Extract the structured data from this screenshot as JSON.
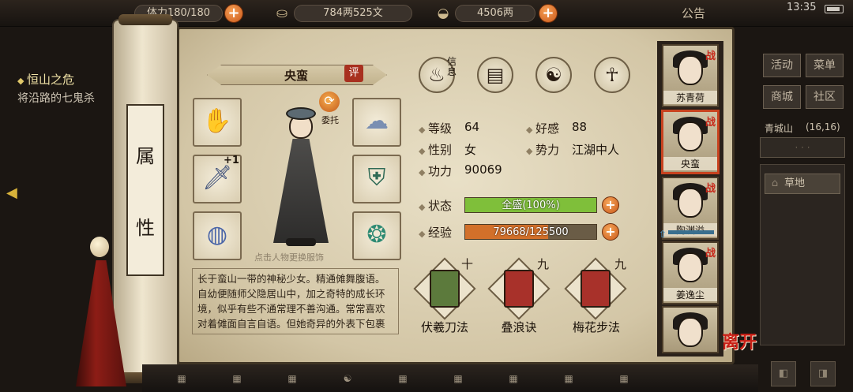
{
  "topbar": {
    "stamina_text": "体力180/180",
    "money_text": "784两525文",
    "gold_text": "4506两",
    "notice_label": "公告",
    "time": "13:35"
  },
  "quest": {
    "title": "恒山之危",
    "desc": "将沿路的七鬼杀"
  },
  "scroll_label": [
    "属",
    "性"
  ],
  "character": {
    "name": "央蛮",
    "rate_label": "评",
    "entrust_label": "委托",
    "change_outfit_hint": "点击人物更换服饰",
    "weapon_plus": "+1",
    "bio": "长于蛮山一带的神秘少女。精通傩舞腹语。自幼便随师父隐居山中，加之奇特的成长环境，似乎有些不通常理不善沟通。常常喜欢对着傩面自言自语。但她奇异的外表下包裹着一颗赤诚纯善的心"
  },
  "tabs": {
    "first_label": "信息"
  },
  "stats": {
    "level_label": "等级",
    "level": "64",
    "favor_label": "好感",
    "favor": "88",
    "gender_label": "性别",
    "gender": "女",
    "faction_label": "势力",
    "faction": "江湖中人",
    "power_label": "功力",
    "power": "90069",
    "status_label": "状态",
    "status_text": "全盛(100%)",
    "status_pct": 1.0,
    "exp_label": "经验",
    "exp_text": "79668/125500",
    "exp_pct": 0.635
  },
  "skills": [
    {
      "level": "十",
      "name": "伏羲刀法"
    },
    {
      "level": "九",
      "name": "叠浪诀"
    },
    {
      "level": "九",
      "name": "梅花步法"
    }
  ],
  "party": {
    "battle_mark": "战",
    "members": [
      {
        "name": "苏青荷"
      },
      {
        "name": "央蛮"
      },
      {
        "name": "陶渊溢"
      },
      {
        "name": "姜逸尘"
      },
      {
        "name": ""
      }
    ]
  },
  "leave_label": "离开",
  "right_menu": {
    "activity": "活动",
    "menu": "菜单",
    "shop": "商城",
    "community": "社区",
    "location": "青城山",
    "coords": "(16,16)",
    "terrain": "草地"
  },
  "colors": {
    "status_fill": "#7fbf3a",
    "exp_fill": "#d2702a",
    "accent_red": "#c8281a"
  }
}
